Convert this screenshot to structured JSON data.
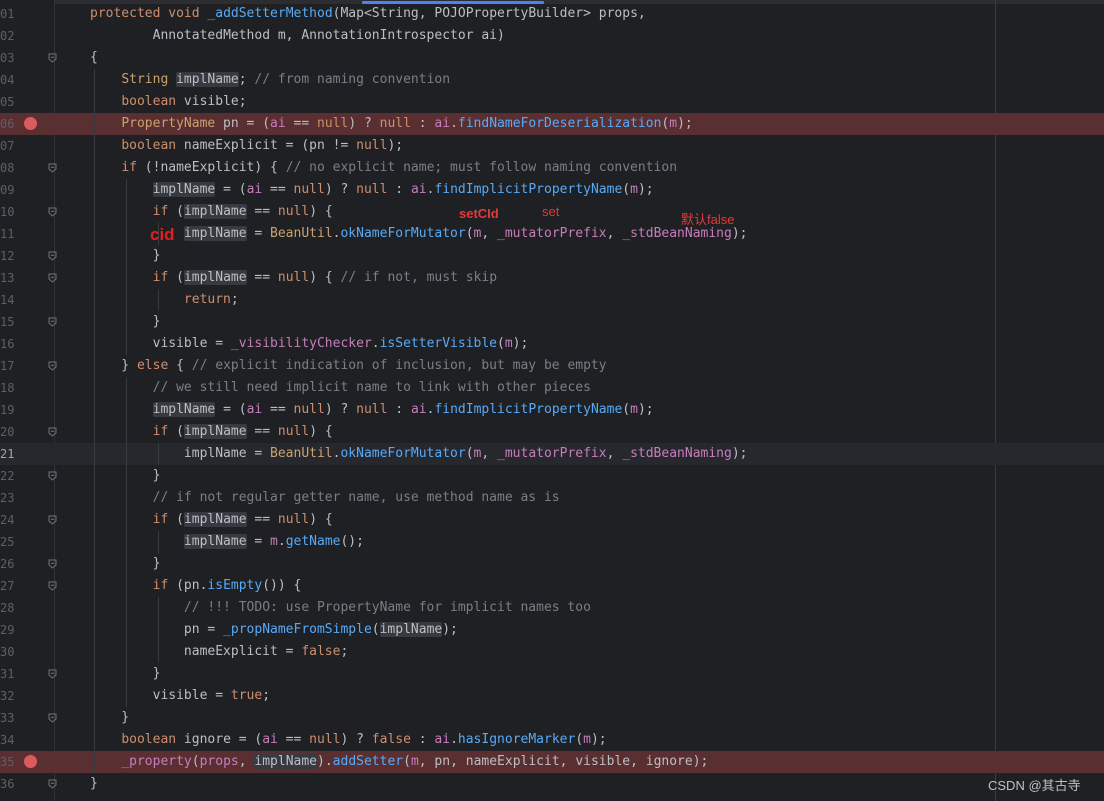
{
  "editor": {
    "gutter_numbers": [
      "01",
      "02",
      "03",
      "04",
      "05",
      "06",
      "07",
      "08",
      "09",
      "10",
      "11",
      "12",
      "13",
      "14",
      "15",
      "16",
      "17",
      "18",
      "19",
      "20",
      "21",
      "22",
      "23",
      "24",
      "25",
      "26",
      "27",
      "28",
      "29",
      "30",
      "31",
      "32",
      "33",
      "34",
      "35",
      "36"
    ],
    "lines": [
      [
        [
          "kw",
          "protected"
        ],
        [
          "pl",
          " "
        ],
        [
          "kw",
          "void"
        ],
        [
          "pl",
          " "
        ],
        [
          "fn",
          "_addSetterMethod"
        ],
        [
          "pl",
          "("
        ],
        [
          "pl",
          "Map<String, POJOPropertyBuilder> props,"
        ]
      ],
      [
        [
          "pl",
          "        "
        ],
        [
          "pl",
          "AnnotatedMethod m, AnnotationIntrospector ai)"
        ]
      ],
      [
        [
          "pl",
          "{"
        ]
      ],
      [
        [
          "pl",
          "    "
        ],
        [
          "ty",
          "String"
        ],
        [
          "pl",
          " "
        ],
        [
          "hl",
          "implName"
        ],
        [
          "pl",
          "; "
        ],
        [
          "cm",
          "// from naming convention"
        ]
      ],
      [
        [
          "pl",
          "    "
        ],
        [
          "kw",
          "boolean"
        ],
        [
          "pl",
          " visible;"
        ]
      ],
      [
        [
          "pl",
          "    "
        ],
        [
          "ty",
          "PropertyName"
        ],
        [
          "pl",
          " pn = ("
        ],
        [
          "fld",
          "ai"
        ],
        [
          "pl",
          " == "
        ],
        [
          "kw",
          "null"
        ],
        [
          "pl",
          ") ? "
        ],
        [
          "kw",
          "null"
        ],
        [
          "pl",
          " : "
        ],
        [
          "fld",
          "ai"
        ],
        [
          "pl",
          "."
        ],
        [
          "fn",
          "findNameForDeserialization"
        ],
        [
          "pl",
          "("
        ],
        [
          "fld",
          "m"
        ],
        [
          "pl",
          ");"
        ]
      ],
      [
        [
          "pl",
          "    "
        ],
        [
          "kw",
          "boolean"
        ],
        [
          "pl",
          " nameExplicit = (pn != "
        ],
        [
          "kw",
          "null"
        ],
        [
          "pl",
          ");"
        ]
      ],
      [
        [
          "pl",
          "    "
        ],
        [
          "kw",
          "if"
        ],
        [
          "pl",
          " (!nameExplicit) { "
        ],
        [
          "cm",
          "// no explicit name; must follow naming convention"
        ]
      ],
      [
        [
          "pl",
          "        "
        ],
        [
          "hl",
          "implName"
        ],
        [
          "pl",
          " = ("
        ],
        [
          "fld",
          "ai"
        ],
        [
          "pl",
          " == "
        ],
        [
          "kw",
          "null"
        ],
        [
          "pl",
          ") ? "
        ],
        [
          "kw",
          "null"
        ],
        [
          "pl",
          " : "
        ],
        [
          "fld",
          "ai"
        ],
        [
          "pl",
          "."
        ],
        [
          "fn",
          "findImplicitPropertyName"
        ],
        [
          "pl",
          "("
        ],
        [
          "fld",
          "m"
        ],
        [
          "pl",
          ");"
        ]
      ],
      [
        [
          "pl",
          "        "
        ],
        [
          "kw",
          "if"
        ],
        [
          "pl",
          " ("
        ],
        [
          "hl",
          "implName"
        ],
        [
          "pl",
          " == "
        ],
        [
          "kw",
          "null"
        ],
        [
          "pl",
          ") {"
        ]
      ],
      [
        [
          "pl",
          "            "
        ],
        [
          "hl",
          "implName"
        ],
        [
          "pl",
          " = "
        ],
        [
          "ty",
          "BeanUtil"
        ],
        [
          "pl",
          "."
        ],
        [
          "fn",
          "okNameForMutator"
        ],
        [
          "pl",
          "("
        ],
        [
          "fld",
          "m"
        ],
        [
          "pl",
          ", "
        ],
        [
          "fld",
          "_mutatorPrefix"
        ],
        [
          "pl",
          ", "
        ],
        [
          "fld",
          "_stdBeanNaming"
        ],
        [
          "pl",
          ");"
        ]
      ],
      [
        [
          "pl",
          "        }"
        ]
      ],
      [
        [
          "pl",
          "        "
        ],
        [
          "kw",
          "if"
        ],
        [
          "pl",
          " ("
        ],
        [
          "hl",
          "implName"
        ],
        [
          "pl",
          " == "
        ],
        [
          "kw",
          "null"
        ],
        [
          "pl",
          ") { "
        ],
        [
          "cm",
          "// if not, must skip"
        ]
      ],
      [
        [
          "pl",
          "            "
        ],
        [
          "kw",
          "return"
        ],
        [
          "pl",
          ";"
        ]
      ],
      [
        [
          "pl",
          "        }"
        ]
      ],
      [
        [
          "pl",
          "        visible = "
        ],
        [
          "fld",
          "_visibilityChecker"
        ],
        [
          "pl",
          "."
        ],
        [
          "fn",
          "isSetterVisible"
        ],
        [
          "pl",
          "("
        ],
        [
          "fld",
          "m"
        ],
        [
          "pl",
          ");"
        ]
      ],
      [
        [
          "pl",
          "    } "
        ],
        [
          "kw",
          "else"
        ],
        [
          "pl",
          " { "
        ],
        [
          "cm",
          "// explicit indication of inclusion, but may be empty"
        ]
      ],
      [
        [
          "pl",
          "        "
        ],
        [
          "cm",
          "// we still need implicit name to link with other pieces"
        ]
      ],
      [
        [
          "pl",
          "        "
        ],
        [
          "hl",
          "implName"
        ],
        [
          "pl",
          " = ("
        ],
        [
          "fld",
          "ai"
        ],
        [
          "pl",
          " == "
        ],
        [
          "kw",
          "null"
        ],
        [
          "pl",
          ") ? "
        ],
        [
          "kw",
          "null"
        ],
        [
          "pl",
          " : "
        ],
        [
          "fld",
          "ai"
        ],
        [
          "pl",
          "."
        ],
        [
          "fn",
          "findImplicitPropertyName"
        ],
        [
          "pl",
          "("
        ],
        [
          "fld",
          "m"
        ],
        [
          "pl",
          ");"
        ]
      ],
      [
        [
          "pl",
          "        "
        ],
        [
          "kw",
          "if"
        ],
        [
          "pl",
          " ("
        ],
        [
          "hl",
          "implName"
        ],
        [
          "pl",
          " == "
        ],
        [
          "kw",
          "null"
        ],
        [
          "pl",
          ") {"
        ]
      ],
      [
        [
          "pl",
          "            implName = "
        ],
        [
          "ty",
          "BeanUtil"
        ],
        [
          "pl",
          "."
        ],
        [
          "fn",
          "okNameForMutator"
        ],
        [
          "pl",
          "("
        ],
        [
          "fld",
          "m"
        ],
        [
          "pl",
          ", "
        ],
        [
          "fld",
          "_mutatorPrefix"
        ],
        [
          "pl",
          ", "
        ],
        [
          "fld",
          "_stdBeanNaming"
        ],
        [
          "pl",
          ");"
        ]
      ],
      [
        [
          "pl",
          "        }"
        ]
      ],
      [
        [
          "pl",
          "        "
        ],
        [
          "cm",
          "// if not regular getter name, use method name as is"
        ]
      ],
      [
        [
          "pl",
          "        "
        ],
        [
          "kw",
          "if"
        ],
        [
          "pl",
          " ("
        ],
        [
          "hl",
          "implName"
        ],
        [
          "pl",
          " == "
        ],
        [
          "kw",
          "null"
        ],
        [
          "pl",
          ") {"
        ]
      ],
      [
        [
          "pl",
          "            "
        ],
        [
          "hl",
          "implName"
        ],
        [
          "pl",
          " = "
        ],
        [
          "fld",
          "m"
        ],
        [
          "pl",
          "."
        ],
        [
          "fn",
          "getName"
        ],
        [
          "pl",
          "();"
        ]
      ],
      [
        [
          "pl",
          "        }"
        ]
      ],
      [
        [
          "pl",
          "        "
        ],
        [
          "kw",
          "if"
        ],
        [
          "pl",
          " (pn."
        ],
        [
          "fn",
          "isEmpty"
        ],
        [
          "pl",
          "()) {"
        ]
      ],
      [
        [
          "pl",
          "            "
        ],
        [
          "cm",
          "// !!! TODO: use PropertyName for implicit names too"
        ]
      ],
      [
        [
          "pl",
          "            pn = "
        ],
        [
          "fn",
          "_propNameFromSimple"
        ],
        [
          "pl",
          "("
        ],
        [
          "hl",
          "implName"
        ],
        [
          "pl",
          ");"
        ]
      ],
      [
        [
          "pl",
          "            nameExplicit = "
        ],
        [
          "kw",
          "false"
        ],
        [
          "pl",
          ";"
        ]
      ],
      [
        [
          "pl",
          "        }"
        ]
      ],
      [
        [
          "pl",
          "        visible = "
        ],
        [
          "kw",
          "true"
        ],
        [
          "pl",
          ";"
        ]
      ],
      [
        [
          "pl",
          "    }"
        ]
      ],
      [
        [
          "pl",
          "    "
        ],
        [
          "kw",
          "boolean"
        ],
        [
          "pl",
          " ignore = ("
        ],
        [
          "fld",
          "ai"
        ],
        [
          "pl",
          " == "
        ],
        [
          "kw",
          "null"
        ],
        [
          "pl",
          ") ? "
        ],
        [
          "kw",
          "false"
        ],
        [
          "pl",
          " : "
        ],
        [
          "fld",
          "ai"
        ],
        [
          "pl",
          "."
        ],
        [
          "fn",
          "hasIgnoreMarker"
        ],
        [
          "pl",
          "("
        ],
        [
          "fld",
          "m"
        ],
        [
          "pl",
          ");"
        ]
      ],
      [
        [
          "pl",
          "    "
        ],
        [
          "fld",
          "_property"
        ],
        [
          "pl",
          "("
        ],
        [
          "fld",
          "props"
        ],
        [
          "pl",
          ", "
        ],
        [
          "hl",
          "implName"
        ],
        [
          "pl",
          ")."
        ],
        [
          "fn",
          "addSetter"
        ],
        [
          "pl",
          "("
        ],
        [
          "fld",
          "m"
        ],
        [
          "pl",
          ", pn, nameExplicit, visible, ignore);"
        ]
      ],
      [
        [
          "pl",
          "}"
        ]
      ]
    ],
    "breakpoint_lines": [
      6,
      35
    ],
    "current_line": 21,
    "fold_lines": [
      3,
      8,
      10,
      12,
      13,
      15,
      17,
      20,
      22,
      24,
      26,
      27,
      31,
      33,
      36
    ]
  },
  "annotations": {
    "setcid": "setCId",
    "set": "set",
    "default_false": "默认false",
    "cid": "cid"
  },
  "watermark": "CSDN @其古寺"
}
